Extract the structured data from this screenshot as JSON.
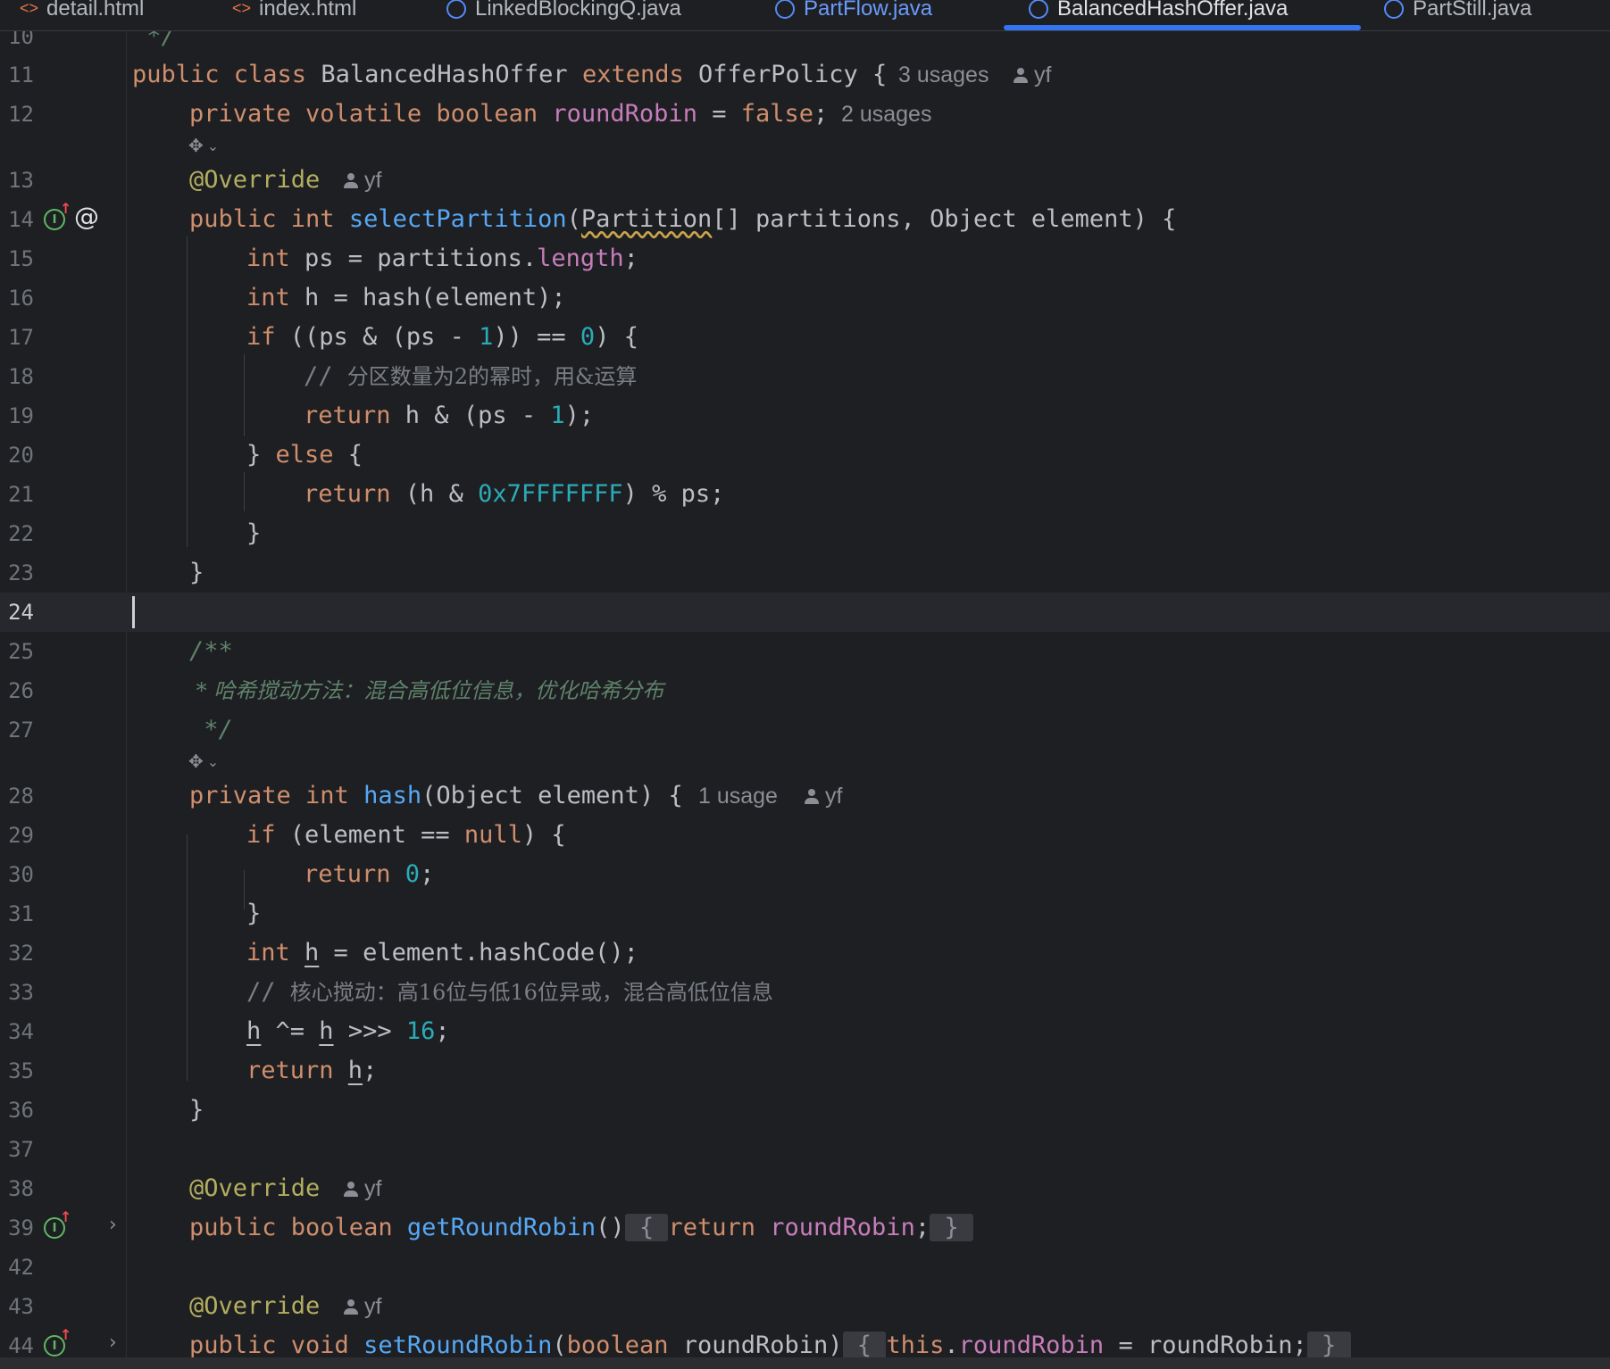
{
  "tabs": [
    {
      "label": "detail.html",
      "icon": "html-file-icon",
      "state": "normal"
    },
    {
      "label": "index.html",
      "icon": "html-file-icon",
      "state": "normal"
    },
    {
      "label": "LinkedBlockingQ.java",
      "icon": "java-class-icon",
      "state": "normal"
    },
    {
      "label": "PartFlow.java",
      "icon": "java-class-icon",
      "state": "modified"
    },
    {
      "label": "BalancedHashOffer.java",
      "icon": "java-class-icon",
      "state": "active"
    },
    {
      "label": "PartStill.java",
      "icon": "java-class-icon",
      "state": "normal"
    }
  ],
  "line_numbers": {
    "l10": "10",
    "l11": "11",
    "l12": "12",
    "l13": "13",
    "l14": "14",
    "l15": "15",
    "l16": "16",
    "l17": "17",
    "l18": "18",
    "l19": "19",
    "l20": "20",
    "l21": "21",
    "l22": "22",
    "l23": "23",
    "l24": "24",
    "l25": "25",
    "l26": "26",
    "l27": "27",
    "l28": "28",
    "l29": "29",
    "l30": "30",
    "l31": "31",
    "l32": "32",
    "l33": "33",
    "l34": "34",
    "l35": "35",
    "l36": "36",
    "l37": "37",
    "l38": "38",
    "l39": "39",
    "l42": "42",
    "l43": "43",
    "l44": "44"
  },
  "code": {
    "l10": {
      "doc_end": " */"
    },
    "l11": {
      "kw1": "public class ",
      "name": "BalancedHashOffer ",
      "kw2": "extends ",
      "parent": "OfferPolicy {"
    },
    "l12": {
      "kw": "private volatile boolean ",
      "field": "roundRobin",
      "mid": " = ",
      "val": "false",
      "end": ";"
    },
    "l13": {
      "ann": "@Override"
    },
    "l14": {
      "kw": "public int ",
      "fn": "selectPartition",
      "p1": "(",
      "type": "Partition",
      "rest": "[] partitions, Object element) {"
    },
    "l15": {
      "kw": "int ",
      "a": "ps = partitions.",
      "field": "length",
      "end": ";"
    },
    "l16": {
      "kw": "int ",
      "a": "h = hash(element);"
    },
    "l17": {
      "kw": "if ",
      "a": "((ps & (ps - ",
      "n1": "1",
      "b": ")) == ",
      "n2": "0",
      "c": ") {"
    },
    "l18": {
      "slashes": "// ",
      "text": "分区数量为2的幂时，用&运算"
    },
    "l19": {
      "kw": "return ",
      "a": "h & (ps - ",
      "n": "1",
      "b": ");"
    },
    "l20": {
      "a": "} ",
      "kw": "else",
      "b": " {"
    },
    "l21": {
      "kw": "return ",
      "a": "(h & ",
      "hex": "0x7FFFFFFF",
      "b": ") % ps;"
    },
    "l22": {
      "a": "}"
    },
    "l23": {
      "a": "}"
    },
    "l25": {
      "doc": "/**"
    },
    "l26": {
      "doc": " * 哈希搅动方法：混合高低位信息，优化哈希分布"
    },
    "l27": {
      "doc": " */"
    },
    "l28": {
      "kw": "private int ",
      "fn": "hash",
      "rest": "(Object element) {"
    },
    "l29": {
      "kw": "if ",
      "a": "(element == ",
      "kw2": "null",
      "b": ") {"
    },
    "l30": {
      "kw": "return ",
      "n": "0",
      "b": ";"
    },
    "l31": {
      "a": "}"
    },
    "l32": {
      "kw": "int ",
      "var": "h",
      "rest": " = element.hashCode();"
    },
    "l33": {
      "slashes": "// ",
      "text": "核心搅动：高16位与低16位异或，混合高低位信息"
    },
    "l34": {
      "v1": "h",
      "a": " ^= ",
      "v2": "h",
      "b": " >>> ",
      "n": "16",
      "c": ";"
    },
    "l35": {
      "kw": "return ",
      "var": "h",
      "b": ";"
    },
    "l36": {
      "a": "}"
    },
    "l38": {
      "ann": "@Override"
    },
    "l39": {
      "kw": "public boolean ",
      "fn": "getRoundRobin",
      "p": "()",
      "f1": " { ",
      "kw2": "return ",
      "field": "roundRobin",
      "semi": ";",
      "f2": " } "
    },
    "l43": {
      "ann": "@Override"
    },
    "l44": {
      "kw": "public void ",
      "fn": "setRoundRobin",
      "p1": "(",
      "kw2": "boolean",
      "p2": " roundRobin)",
      "f1": " { ",
      "kw3": "this",
      "dot": ".",
      "field": "roundRobin",
      "rest": " = roundRobin;",
      "f2": " } "
    }
  },
  "hints": {
    "class_usages": "3 usages",
    "class_author": "yf",
    "field_usages": "2 usages",
    "override1_author": "yf",
    "hash_usages": "1 usage",
    "hash_author": "yf",
    "override2_author": "yf",
    "override3_author": "yf"
  },
  "icons": {
    "implements": "I",
    "at": "@",
    "arrow": "↑",
    "chevron": "›",
    "ai": "✥",
    "ai_chevron": "⌄"
  },
  "colors": {
    "background": "#1e1f22",
    "keyword": "#cf8e6d",
    "field": "#c77dbb",
    "function": "#56a8f5",
    "number": "#2aacb8",
    "annotation": "#b3ae60",
    "comment": "#7a7e85",
    "doc_comment": "#5f826b",
    "active_tab_underline": "#3574f0"
  }
}
